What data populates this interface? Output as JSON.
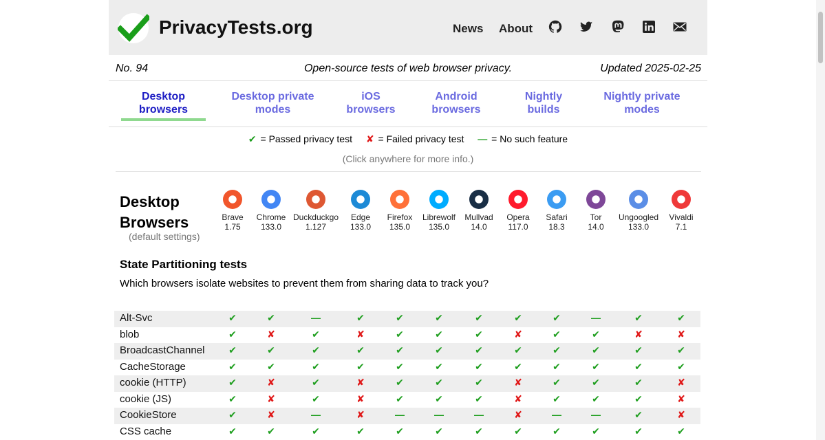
{
  "site": {
    "title": "PrivacyTests.org"
  },
  "nav": {
    "news": "News",
    "about": "About",
    "icons": [
      "github-icon",
      "twitter-icon",
      "mastodon-icon",
      "linkedin-icon",
      "email-icon"
    ]
  },
  "info": {
    "issue": "No. 94",
    "tagline": "Open-source tests of web browser privacy.",
    "updated": "Updated 2025-02-25"
  },
  "tabs": [
    {
      "line1": "Desktop",
      "line2": "browsers",
      "active": true
    },
    {
      "line1": "Desktop private",
      "line2": "modes",
      "active": false
    },
    {
      "line1": "iOS",
      "line2": "browsers",
      "active": false
    },
    {
      "line1": "Android",
      "line2": "browsers",
      "active": false
    },
    {
      "line1": "Nightly",
      "line2": "builds",
      "active": false
    },
    {
      "line1": "Nightly private",
      "line2": "modes",
      "active": false
    }
  ],
  "legend": {
    "passed": "= Passed privacy test",
    "failed": "= Failed privacy test",
    "none": "= No such feature",
    "hint": "(Click anywhere for more info.)"
  },
  "section": {
    "title_line1": "Desktop",
    "title_line2": "Browsers",
    "subtitle": "(default settings)"
  },
  "browsers": [
    {
      "name": "Brave",
      "version": "1.75",
      "color": "#f1562c"
    },
    {
      "name": "Chrome",
      "version": "133.0",
      "color": "#4286f4"
    },
    {
      "name": "Duckduckgo",
      "version": "1.127",
      "color": "#de5833"
    },
    {
      "name": "Edge",
      "version": "133.0",
      "color": "#1d8ad6"
    },
    {
      "name": "Firefox",
      "version": "135.0",
      "color": "#ff7139"
    },
    {
      "name": "Librewolf",
      "version": "135.0",
      "color": "#00acff"
    },
    {
      "name": "Mullvad",
      "version": "14.0",
      "color": "#192e45"
    },
    {
      "name": "Opera",
      "version": "117.0",
      "color": "#ff1b2d"
    },
    {
      "name": "Safari",
      "version": "18.3",
      "color": "#3b9cf2"
    },
    {
      "name": "Tor",
      "version": "14.0",
      "color": "#7e4798"
    },
    {
      "name": "Ungoogled",
      "version": "133.0",
      "color": "#5b8ee6"
    },
    {
      "name": "Vivaldi",
      "version": "7.1",
      "color": "#ef3939"
    }
  ],
  "tests": {
    "title": "State Partitioning tests",
    "description": "Which browsers isolate websites to prevent them from sharing data to track you?",
    "rows": [
      {
        "label": "Alt-Svc",
        "results": [
          "pass",
          "pass",
          "none",
          "pass",
          "pass",
          "pass",
          "pass",
          "pass",
          "pass",
          "none",
          "pass",
          "pass"
        ]
      },
      {
        "label": "blob",
        "results": [
          "pass",
          "fail",
          "pass",
          "fail",
          "pass",
          "pass",
          "pass",
          "fail",
          "pass",
          "pass",
          "fail",
          "fail"
        ]
      },
      {
        "label": "BroadcastChannel",
        "results": [
          "pass",
          "pass",
          "pass",
          "pass",
          "pass",
          "pass",
          "pass",
          "pass",
          "pass",
          "pass",
          "pass",
          "pass"
        ]
      },
      {
        "label": "CacheStorage",
        "results": [
          "pass",
          "pass",
          "pass",
          "pass",
          "pass",
          "pass",
          "pass",
          "pass",
          "pass",
          "pass",
          "pass",
          "pass"
        ]
      },
      {
        "label": "cookie (HTTP)",
        "results": [
          "pass",
          "fail",
          "pass",
          "fail",
          "pass",
          "pass",
          "pass",
          "fail",
          "pass",
          "pass",
          "pass",
          "fail"
        ]
      },
      {
        "label": "cookie (JS)",
        "results": [
          "pass",
          "fail",
          "pass",
          "fail",
          "pass",
          "pass",
          "pass",
          "fail",
          "pass",
          "pass",
          "pass",
          "fail"
        ]
      },
      {
        "label": "CookieStore",
        "results": [
          "pass",
          "fail",
          "none",
          "fail",
          "none",
          "none",
          "none",
          "fail",
          "none",
          "none",
          "pass",
          "fail"
        ]
      },
      {
        "label": "CSS cache",
        "results": [
          "pass",
          "pass",
          "pass",
          "pass",
          "pass",
          "pass",
          "pass",
          "pass",
          "pass",
          "pass",
          "pass",
          "pass"
        ]
      }
    ]
  }
}
